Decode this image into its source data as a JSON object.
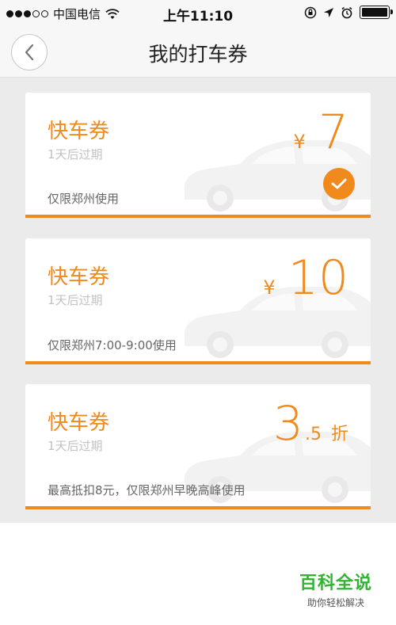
{
  "status_bar": {
    "carrier": "中国电信",
    "time": "上午11:10",
    "signal_bars_filled": 3,
    "signal_bars_total": 5
  },
  "nav": {
    "title": "我的打车券",
    "back_icon": "chevron-left-icon"
  },
  "coupons": [
    {
      "title": "快车券",
      "expire": "1天后过期",
      "note": "仅限郑州使用",
      "currency": "¥",
      "amount": "7",
      "selected": true
    },
    {
      "title": "快车券",
      "expire": "1天后过期",
      "note": "仅限郑州7:00-9:00使用",
      "currency": "¥",
      "amount": "10",
      "selected": false
    },
    {
      "title": "快车券",
      "expire": "1天后过期",
      "note": "最高抵扣8元，仅限郑州早晚高峰使用",
      "amount_major": "3",
      "amount_minor": ".5",
      "discount_label": "折",
      "selected": false
    }
  ],
  "watermark": {
    "main": "百科全说",
    "sub": "助你轻松解决"
  },
  "colors": {
    "accent": "#f08a1c",
    "background": "#ebebeb",
    "watermark": "#2fb52f"
  }
}
